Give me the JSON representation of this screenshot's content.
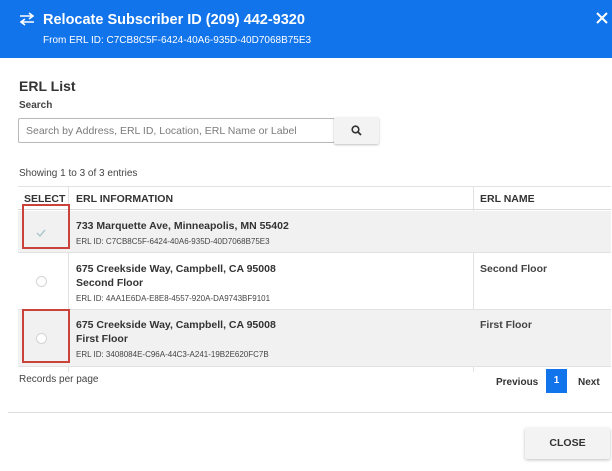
{
  "dialog": {
    "title": "Relocate Subscriber ID (209) 442-9320",
    "subtitle": "From ERL ID: C7CB8C5F-6424-40A6-935D-40D7068B75E3",
    "header_color": "#1274ea",
    "icons": {
      "header": "swap-arrows-icon",
      "close": "close-icon"
    }
  },
  "erl_list": {
    "title": "ERL List",
    "search_label": "Search",
    "search_placeholder": "Search by Address, ERL ID, Location, ERL Name or Label",
    "search_value": "",
    "search_icon": "search-icon",
    "showing_text": "Showing 1 to 3 of 3 entries",
    "columns": [
      "SELECT",
      "ERL INFORMATION",
      "ERL NAME"
    ],
    "rows": [
      {
        "selected": true,
        "address": "733 Marquette Ave, Minneapolis, MN 55402",
        "location": "",
        "erl_id": "ERL ID: C7CB8C5F-6424-40A6-935D-40D7068B75E3",
        "erl_name": ""
      },
      {
        "selected": false,
        "address": "675 Creekside Way, Campbell, CA 95008",
        "location": "Second Floor",
        "erl_id": "ERL ID: 4AA1E6DA-E8E8-4557-920A-DA9743BF9101",
        "erl_name": "Second Floor"
      },
      {
        "selected": false,
        "address": "675 Creekside Way, Campbell, CA 95008",
        "location": "First Floor",
        "erl_id": "ERL ID: 3408084E-C96A-44C3-A241-19B2E620FC7B",
        "erl_name": "First Floor"
      }
    ],
    "highlight_color": "#c9433a"
  },
  "pagination": {
    "records_label": "Records per page",
    "previous": "Previous",
    "current_page": "1",
    "next": "Next"
  },
  "footer": {
    "close_label": "CLOSE"
  }
}
